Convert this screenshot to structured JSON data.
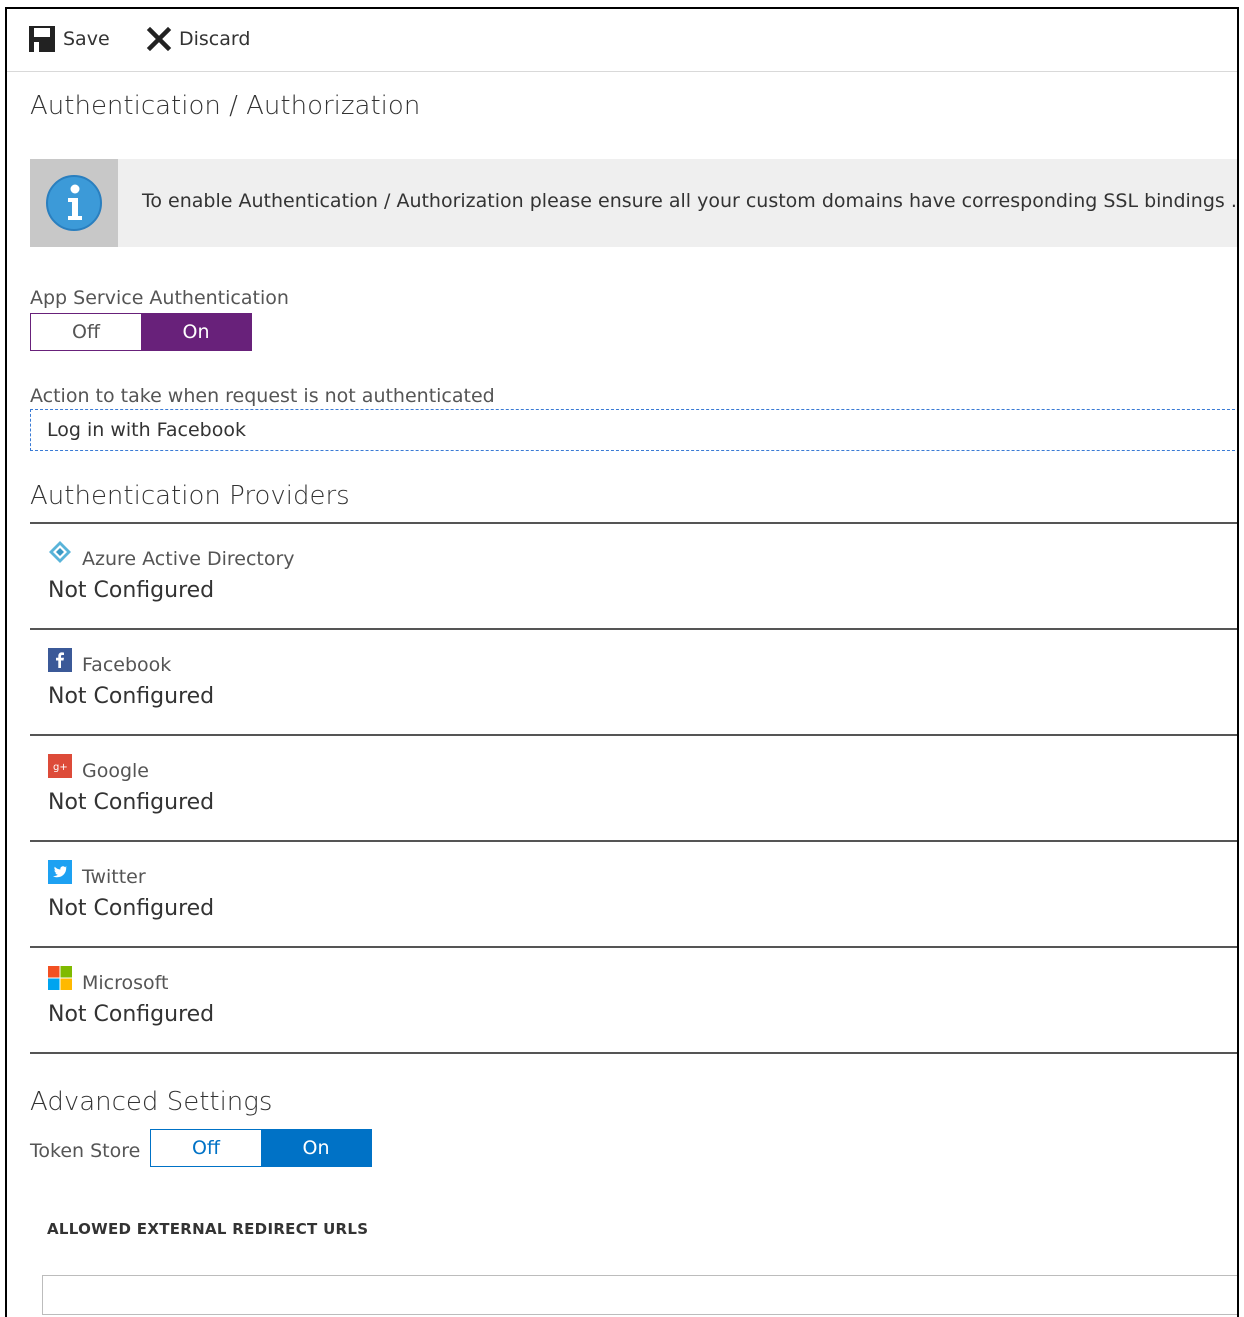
{
  "toolbar": {
    "save_label": "Save",
    "discard_label": "Discard"
  },
  "page_title": "Authentication / Authorization",
  "banner": {
    "message": "To enable Authentication / Authorization please ensure all your custom domains have corresponding SSL bindings .net"
  },
  "app_service_auth": {
    "label": "App Service Authentication",
    "off_label": "Off",
    "on_label": "On",
    "selected": "On",
    "accent": "#68217a"
  },
  "action": {
    "label": "Action to take when request is not authenticated",
    "value": "Log in with Facebook"
  },
  "providers_title": "Authentication Providers",
  "providers": [
    {
      "name": "Azure Active Directory",
      "status": "Not Configured",
      "icon": "azure-ad-icon"
    },
    {
      "name": "Facebook",
      "status": "Not Configured",
      "icon": "facebook-icon"
    },
    {
      "name": "Google",
      "status": "Not Configured",
      "icon": "google-plus-icon"
    },
    {
      "name": "Twitter",
      "status": "Not Configured",
      "icon": "twitter-icon"
    },
    {
      "name": "Microsoft",
      "status": "Not Configured",
      "icon": "microsoft-icon"
    }
  ],
  "advanced": {
    "title": "Advanced Settings",
    "token_store": {
      "label": "Token Store",
      "off_label": "Off",
      "on_label": "On",
      "selected": "On",
      "accent": "#0072c6"
    },
    "redirect_urls_label": "ALLOWED EXTERNAL REDIRECT URLS",
    "redirect_urls_value": ""
  }
}
